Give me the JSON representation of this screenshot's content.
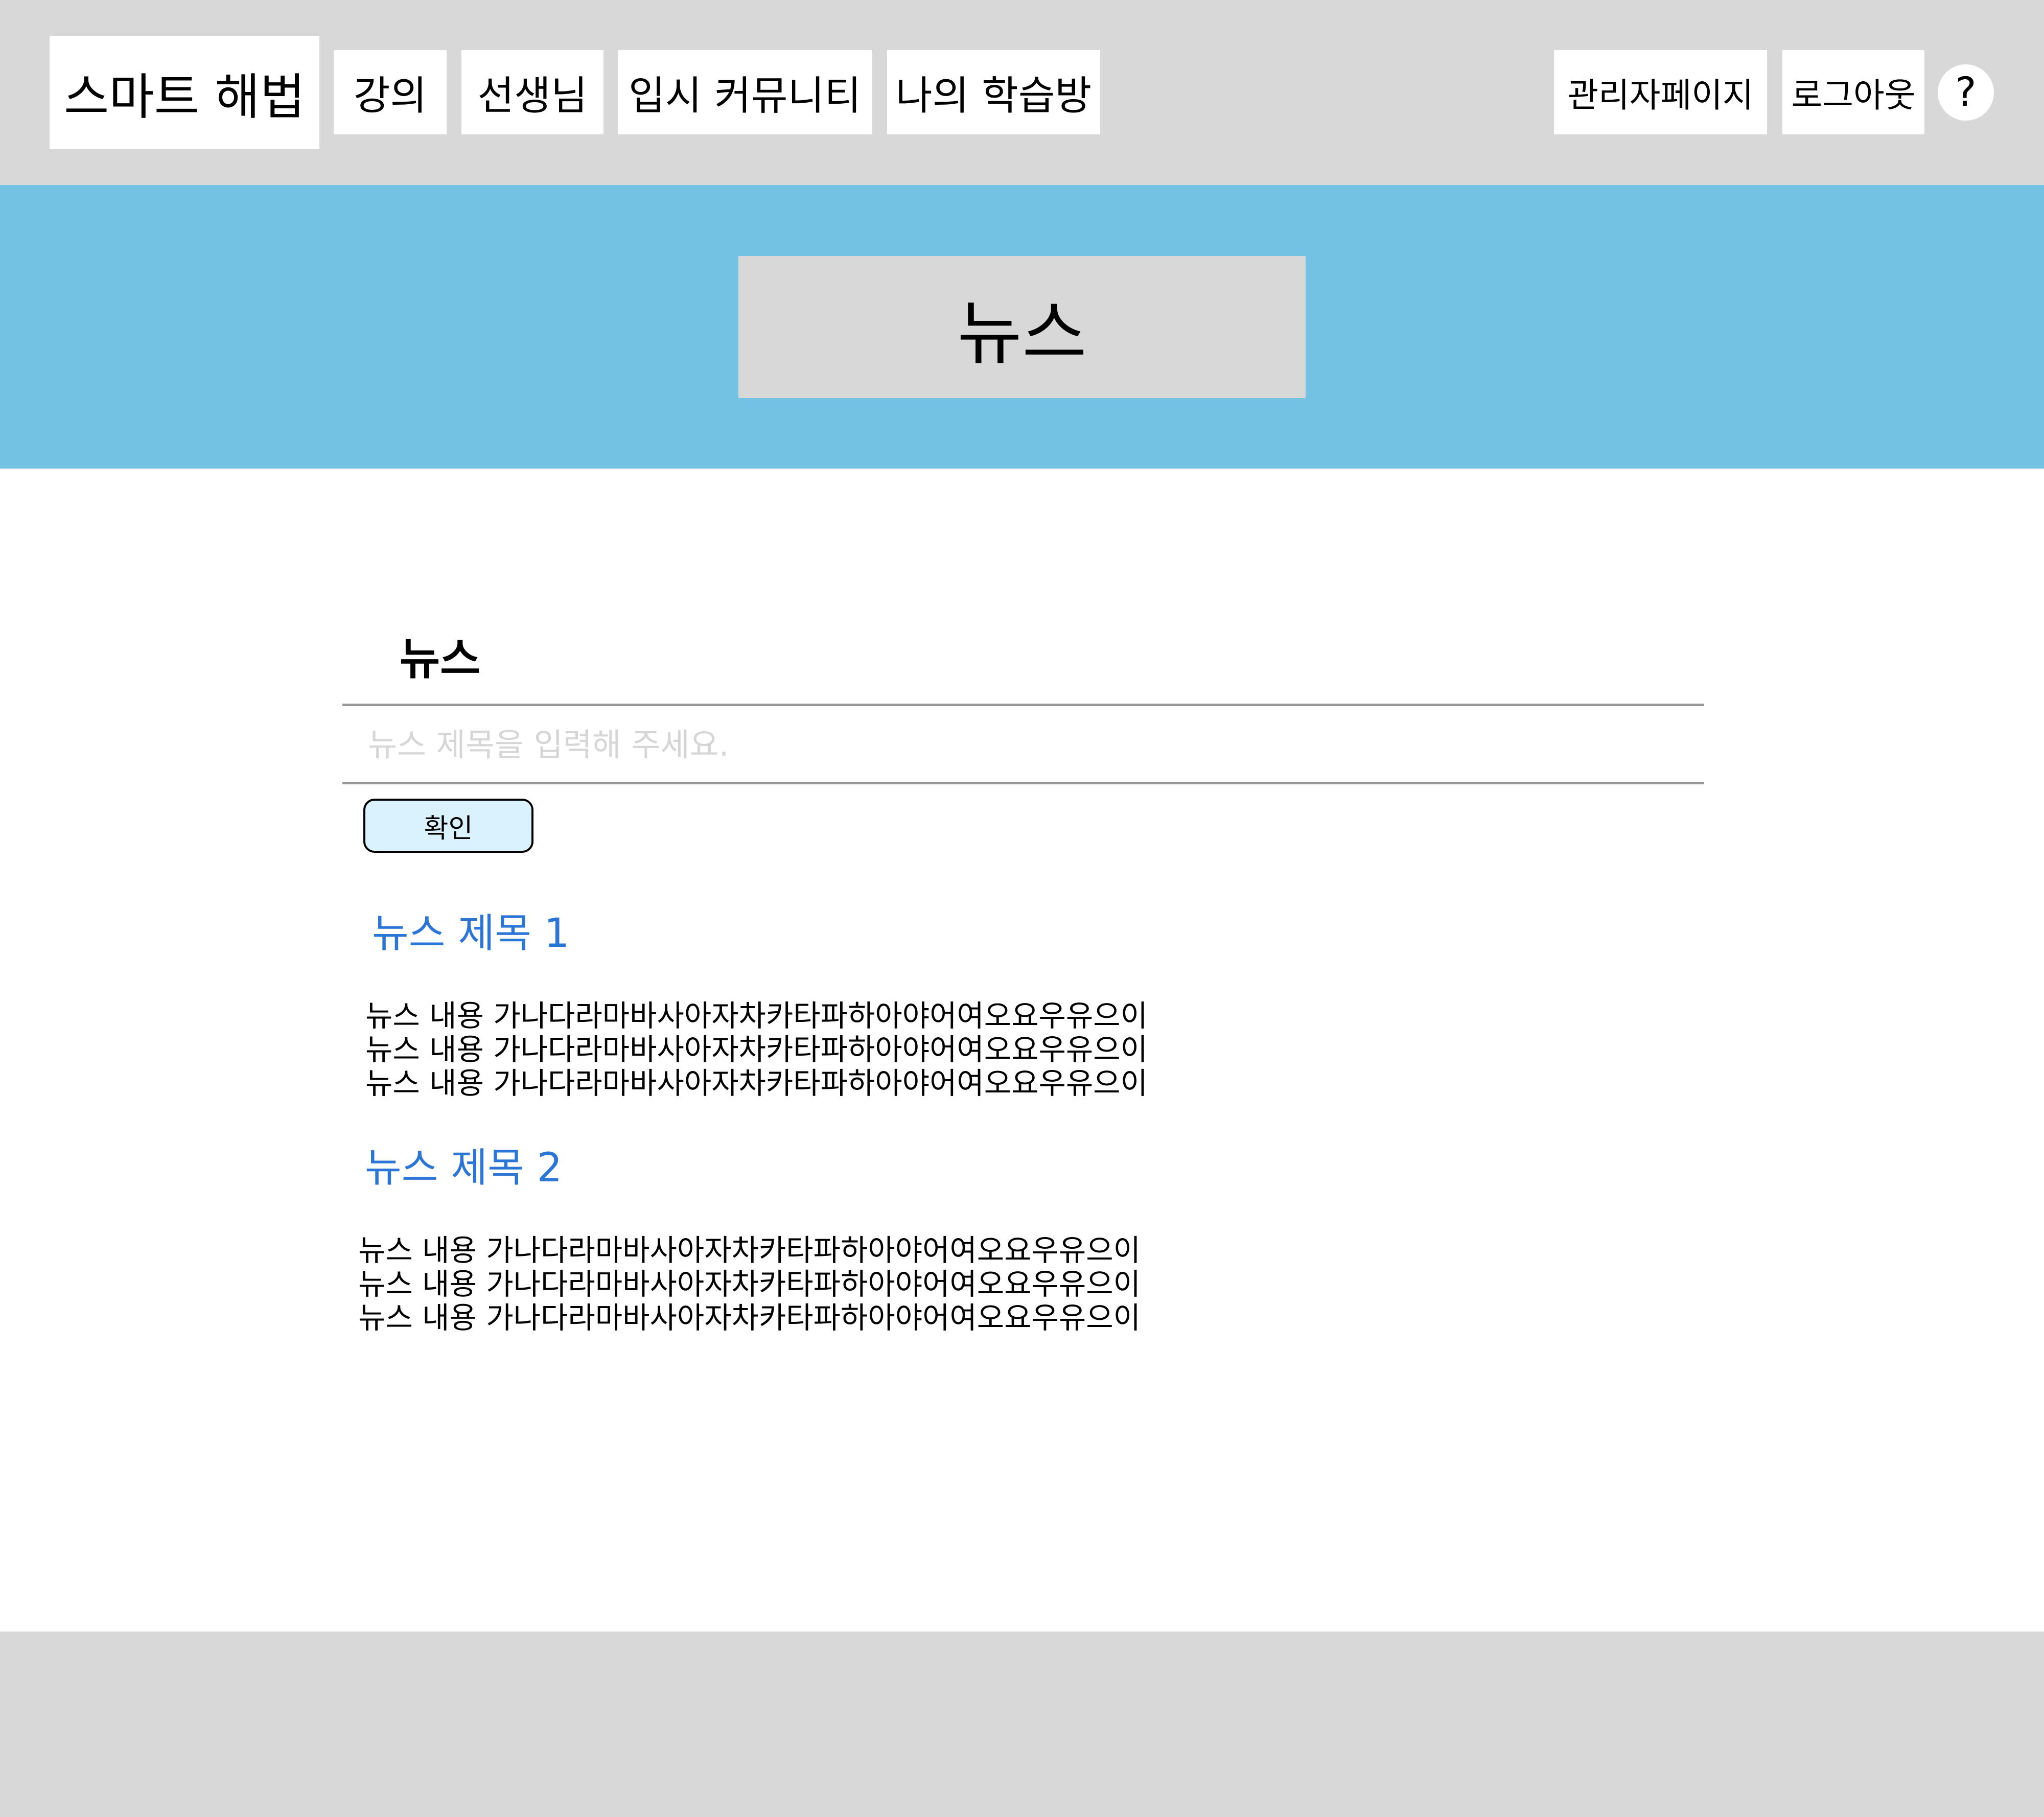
{
  "header": {
    "logo": "스마트 해법",
    "nav": {
      "lecture": "강의",
      "teacher": "선생님",
      "community": "입시 커뮤니티",
      "study_room": "나의 학습방"
    },
    "admin_page": "관리자페이지",
    "logout": "로그아웃",
    "help": "?"
  },
  "banner": {
    "title": "뉴스"
  },
  "main": {
    "section_title": "뉴스",
    "search": {
      "value": "",
      "placeholder": "뉴스 제목을 입력해 주세요."
    },
    "confirm_label": "확인",
    "news": [
      {
        "title": "뉴스 제목 1",
        "lines": [
          "뉴스 내용 가나다라마바사아자차카타파하아야어여오요우유으이",
          "뉴스 내용 가나다라마바사아자차카타파하아야어여오요우유으이",
          "뉴스 내용 가나다라마바사아자차카타파하아야어여오요우유으이"
        ]
      },
      {
        "title": "뉴스 제목 2",
        "lines": [
          "뉴스 내용 가나다라마바사아자차카타파하아야어여오요우유으이",
          "뉴스 내용 가나다라마바사아자차카타파하아야어여오요우유으이",
          "뉴스 내용 가나다라마바사아자차카타파하아야어여오요우유으이"
        ]
      }
    ]
  },
  "colors": {
    "header_bg": "#d8d8d8",
    "banner_bg": "#73c1e3",
    "link": "#2a75d6",
    "button_bg": "#daf2fd"
  }
}
